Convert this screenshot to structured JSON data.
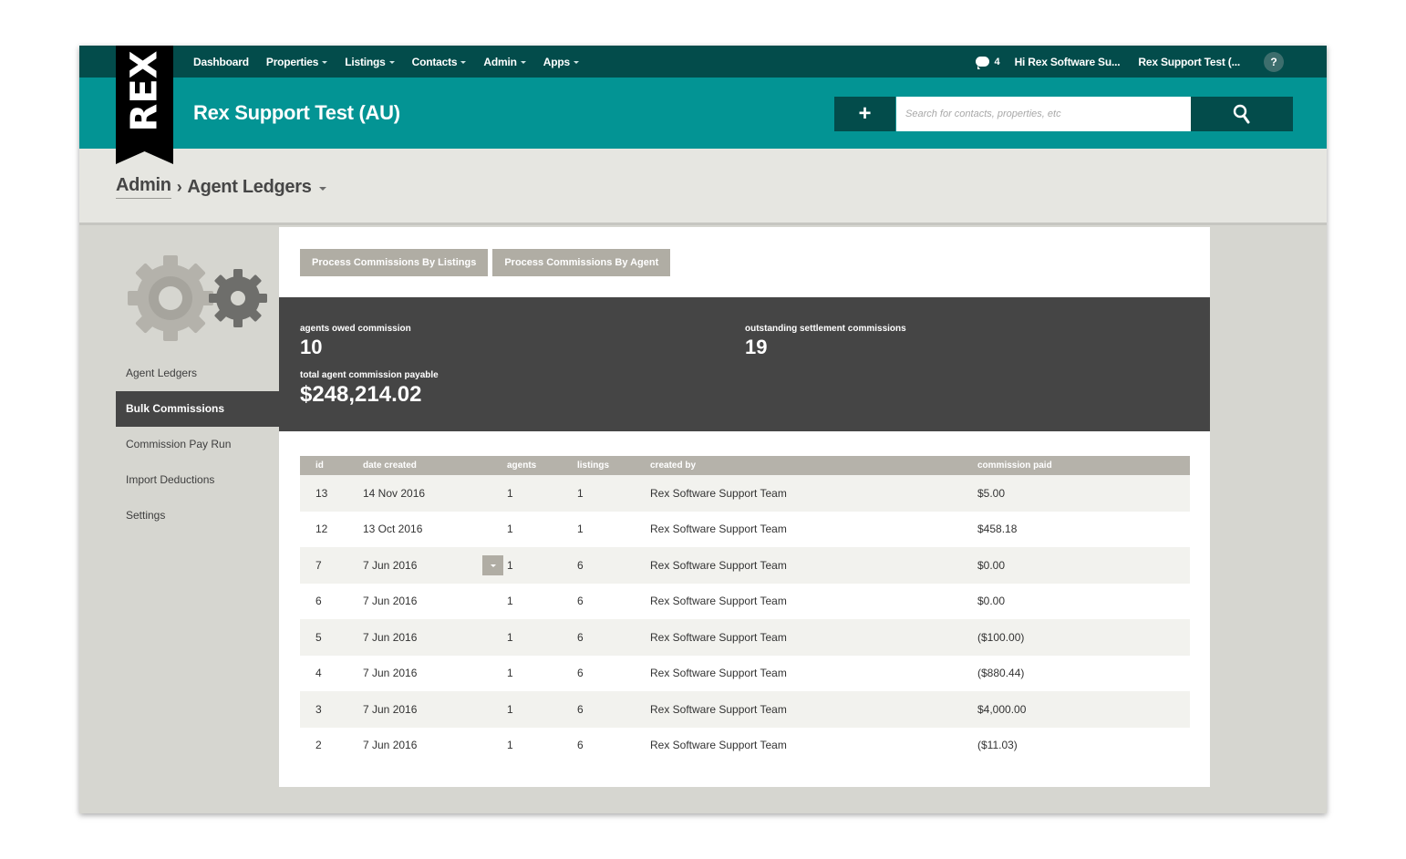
{
  "nav": {
    "items": [
      {
        "label": "Dashboard",
        "caret": false
      },
      {
        "label": "Properties",
        "caret": true
      },
      {
        "label": "Listings",
        "caret": true
      },
      {
        "label": "Contacts",
        "caret": true
      },
      {
        "label": "Admin",
        "caret": true
      },
      {
        "label": "Apps",
        "caret": true
      }
    ],
    "messages_count": "4",
    "user": "Hi Rex Software Su...",
    "account": "Rex Support Test (...",
    "help": "?"
  },
  "logo": {
    "text": "REX"
  },
  "header": {
    "title": "Rex Support Test (AU)",
    "add_label": "+",
    "search_placeholder": "Search for contacts, properties, etc"
  },
  "breadcrumb": {
    "parent": "Admin",
    "separator": "›",
    "current": "Agent Ledgers"
  },
  "sidebar": {
    "items": [
      {
        "label": "Agent Ledgers",
        "active": false
      },
      {
        "label": "Bulk Commissions",
        "active": true
      },
      {
        "label": "Commission Pay Run",
        "active": false
      },
      {
        "label": "Import Deductions",
        "active": false
      },
      {
        "label": "Settings",
        "active": false
      }
    ]
  },
  "actions": {
    "by_listings": "Process Commissions By Listings",
    "by_agent": "Process Commissions By Agent"
  },
  "stats": {
    "agents_owed_label": "agents owed commission",
    "agents_owed_value": "10",
    "outstanding_label": "outstanding settlement commissions",
    "outstanding_value": "19",
    "payable_label": "total agent commission payable",
    "payable_value": "$248,214.02"
  },
  "table": {
    "columns": [
      "id",
      "date created",
      "agents",
      "listings",
      "created by",
      "commission paid"
    ],
    "rows": [
      {
        "id": "13",
        "date": "14 Nov 2016",
        "agents": "1",
        "listings": "1",
        "created_by": "Rex Software Support Team",
        "paid": "$5.00"
      },
      {
        "id": "12",
        "date": "13 Oct 2016",
        "agents": "1",
        "listings": "1",
        "created_by": "Rex Software Support Team",
        "paid": "$458.18"
      },
      {
        "id": "7",
        "date": "7 Jun 2016",
        "agents": "1",
        "listings": "6",
        "created_by": "Rex Software Support Team",
        "paid": "$0.00"
      },
      {
        "id": "6",
        "date": "7 Jun 2016",
        "agents": "1",
        "listings": "6",
        "created_by": "Rex Software Support Team",
        "paid": "$0.00"
      },
      {
        "id": "5",
        "date": "7 Jun 2016",
        "agents": "1",
        "listings": "6",
        "created_by": "Rex Software Support Team",
        "paid": "($100.00)"
      },
      {
        "id": "4",
        "date": "7 Jun 2016",
        "agents": "1",
        "listings": "6",
        "created_by": "Rex Software Support Team",
        "paid": "($880.44)"
      },
      {
        "id": "3",
        "date": "7 Jun 2016",
        "agents": "1",
        "listings": "6",
        "created_by": "Rex Software Support Team",
        "paid": "$4,000.00"
      },
      {
        "id": "2",
        "date": "7 Jun 2016",
        "agents": "1",
        "listings": "6",
        "created_by": "Rex Software Support Team",
        "paid": "($11.03)"
      }
    ]
  }
}
